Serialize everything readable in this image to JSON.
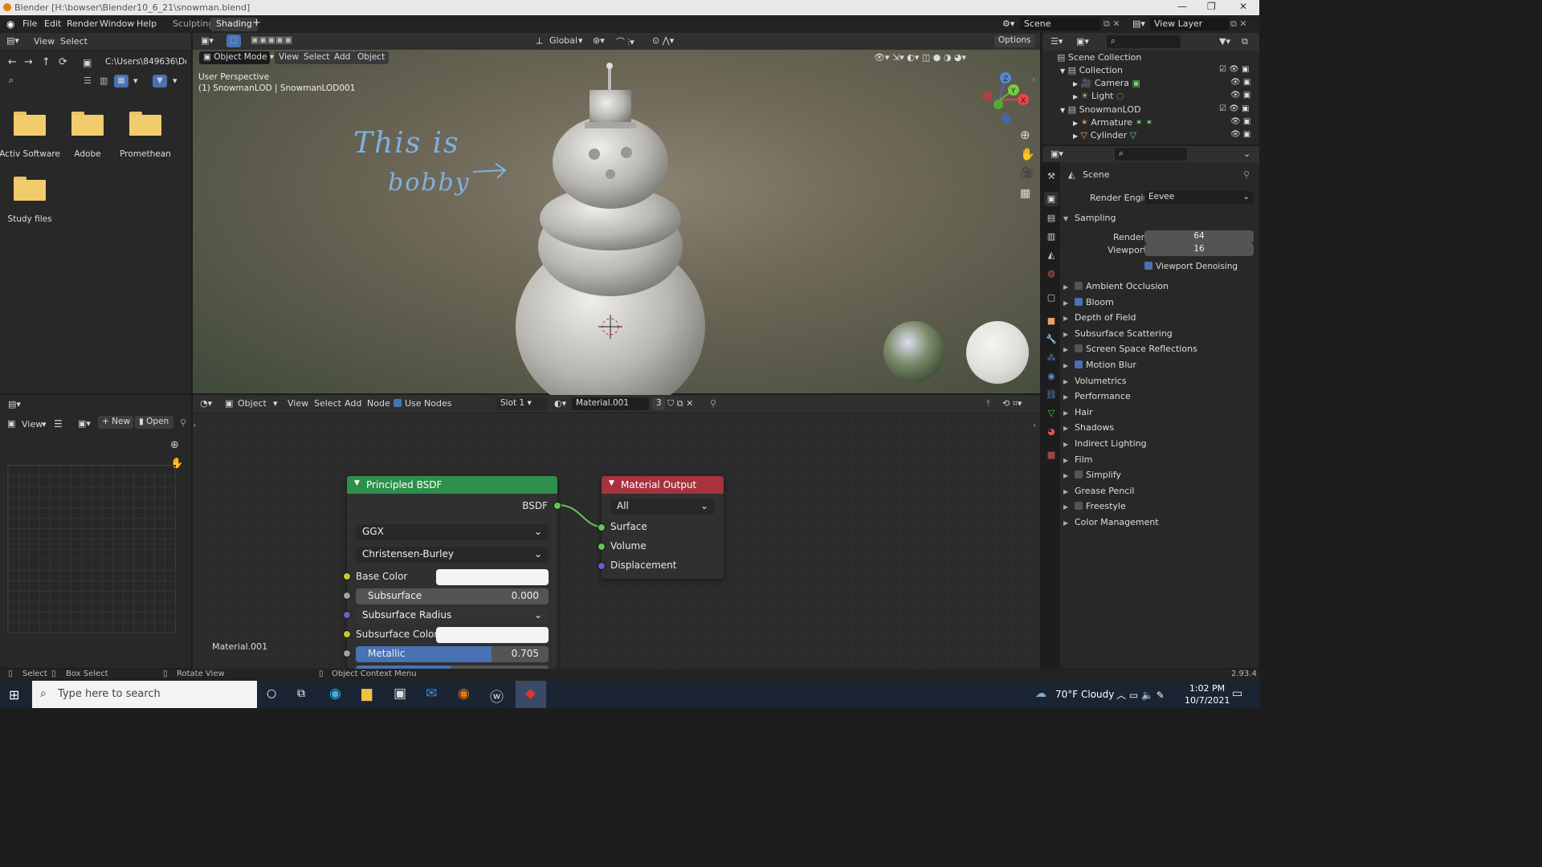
{
  "title_bar": {
    "title": "Blender [H:\\bowser\\Blender10_6_21\\snowman.blend]",
    "controls": [
      "—",
      "❐",
      "✕"
    ]
  },
  "menu": {
    "items": [
      "File",
      "Edit",
      "Render",
      "Window",
      "Help"
    ]
  },
  "workspaces": {
    "tabs": [
      "Sculpting",
      "Shading"
    ],
    "active": "Shading",
    "add": "+"
  },
  "scene": {
    "name": "Scene",
    "view_layer": "View Layer"
  },
  "file_browser": {
    "menu": [
      "View",
      "Select"
    ],
    "path": "C:\\Users\\849636\\Doc...",
    "folders": [
      "Activ Software",
      "Adobe",
      "Promethean",
      "Study files"
    ]
  },
  "viewport": {
    "mode": "Object Mode",
    "menu": [
      "View",
      "Select",
      "Add",
      "Object"
    ],
    "transform": "Global",
    "options": "Options",
    "overlay_line1": "User Perspective",
    "overlay_line2": "(1) SnowmanLOD | SnowmanLOD001",
    "annotation_line1": "This is",
    "annotation_line2": "bobby",
    "gizmo_axes": [
      "X",
      "Y",
      "Z"
    ]
  },
  "image_editor": {
    "view": "View",
    "new": "New",
    "open": "Open"
  },
  "node_editor": {
    "type": "Object",
    "menu": [
      "View",
      "Select",
      "Add",
      "Node"
    ],
    "use_nodes": "Use Nodes",
    "slot": "Slot 1",
    "material": "Material.001",
    "users": "3",
    "material_label": "Material.001",
    "principled": {
      "title": "Principled BSDF",
      "output": "BSDF",
      "distribution": "GGX",
      "subsurface_method": "Christensen-Burley",
      "base_color": "Base Color",
      "subsurface_label": "Subsurface",
      "subsurface_value": "0.000",
      "subsurface_radius": "Subsurface Radius",
      "subsurface_color": "Subsurface Color",
      "metallic_label": "Metallic",
      "metallic_value": "0.705",
      "metallic_fraction": 0.705
    },
    "output_node": {
      "title": "Material Output",
      "target": "All",
      "inputs": [
        "Surface",
        "Volume",
        "Displacement"
      ]
    },
    "colors": {
      "shader_header": "#2d8f4b",
      "output_header": "#a6333d",
      "shader_socket": "#62c554",
      "color_socket": "#c7c729",
      "float_socket": "#a1a1a1",
      "vector_socket": "#6363c7"
    }
  },
  "outliner": {
    "items": [
      {
        "label": "Scene Collection"
      },
      {
        "label": "Collection"
      },
      {
        "label": "Camera"
      },
      {
        "label": "Light"
      },
      {
        "label": "SnowmanLOD"
      },
      {
        "label": "Armature"
      },
      {
        "label": "Cylinder"
      }
    ]
  },
  "properties": {
    "context": "Scene",
    "render_engine_label": "Render Engine",
    "render_engine": "Eevee",
    "sampling": "Sampling",
    "render_label": "Render",
    "render_value": "64",
    "viewport_label": "Viewport",
    "viewport_value": "16",
    "viewport_denoising": "Viewport Denoising",
    "panels": [
      {
        "label": "Ambient Occlusion",
        "checkbox": true,
        "checked": false
      },
      {
        "label": "Bloom",
        "checkbox": true,
        "checked": true
      },
      {
        "label": "Depth of Field",
        "checkbox": false
      },
      {
        "label": "Subsurface Scattering",
        "checkbox": false
      },
      {
        "label": "Screen Space Reflections",
        "checkbox": true,
        "checked": false
      },
      {
        "label": "Motion Blur",
        "checkbox": true,
        "checked": true
      },
      {
        "label": "Volumetrics",
        "checkbox": false
      },
      {
        "label": "Performance",
        "checkbox": false
      },
      {
        "label": "Hair",
        "checkbox": false
      },
      {
        "label": "Shadows",
        "checkbox": false
      },
      {
        "label": "Indirect Lighting",
        "checkbox": false
      },
      {
        "label": "Film",
        "checkbox": false
      },
      {
        "label": "Simplify",
        "checkbox": true,
        "checked": false
      },
      {
        "label": "Grease Pencil",
        "checkbox": false
      },
      {
        "label": "Freestyle",
        "checkbox": true,
        "checked": false
      },
      {
        "label": "Color Management",
        "checkbox": false
      }
    ]
  },
  "status_bar": {
    "select": "Select",
    "box_select": "Box Select",
    "rotate": "Rotate View",
    "context_menu": "Object Context Menu",
    "version": "2.93.4"
  },
  "taskbar": {
    "search_placeholder": "Type here to search",
    "weather": "70°F  Cloudy",
    "time": "1:02 PM",
    "date": "10/7/2021"
  }
}
